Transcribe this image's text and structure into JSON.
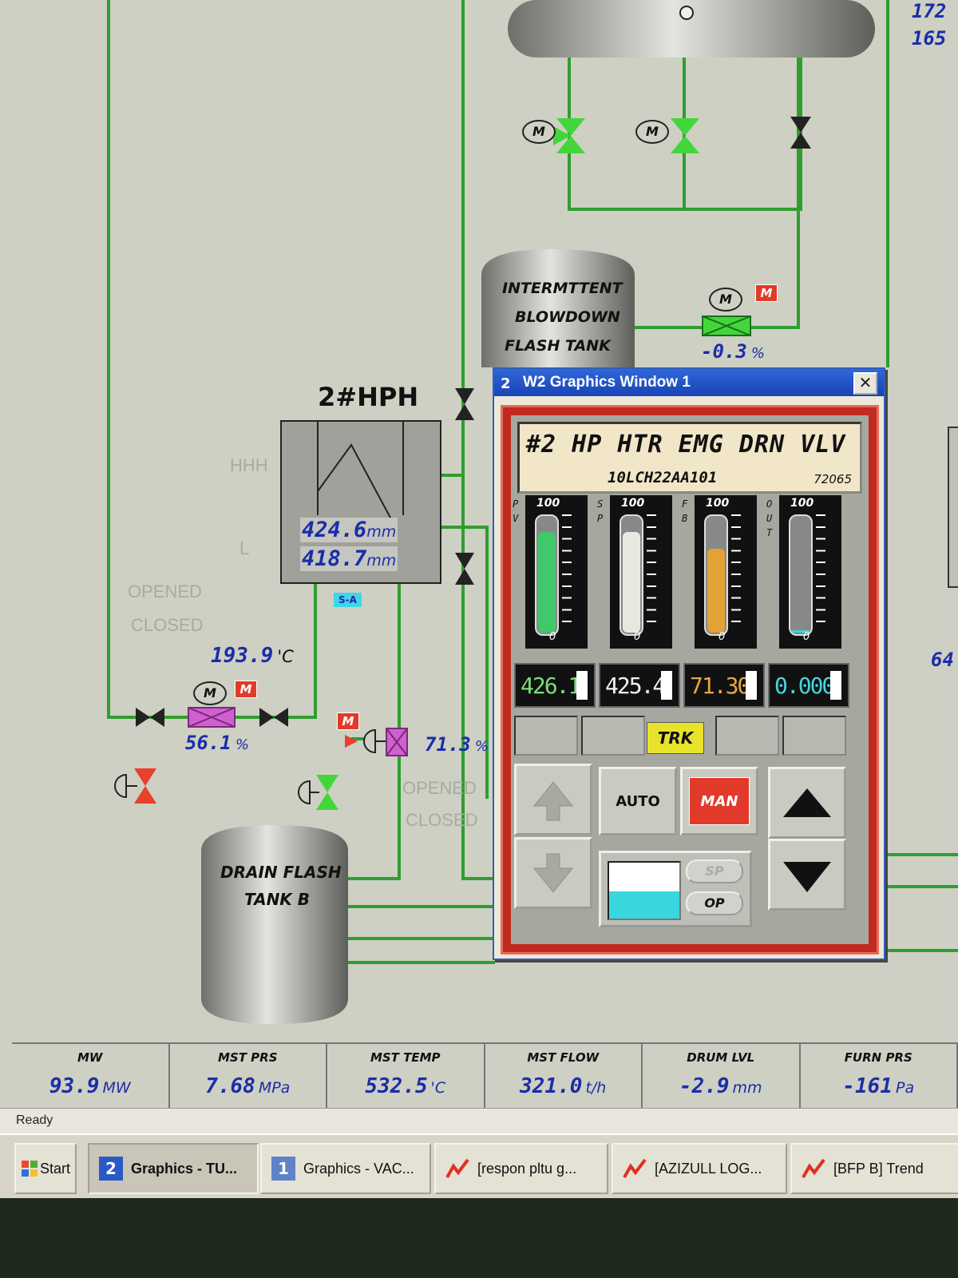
{
  "colors": {
    "pipe": "#2f9e30",
    "valve_green": "#43d63b",
    "valve_red": "#e8412c",
    "valve_magenta": "#d060d0",
    "value_blue": "#1b2da8",
    "bar_pv": "#3fc96a",
    "bar_sp": "#e8e8e0",
    "bar_fb": "#e2a236",
    "bar_out": "#39d6de"
  },
  "top_right_values": [
    "172",
    "165"
  ],
  "right_edge_value": "64",
  "vessels": {
    "intermittent": {
      "lines": [
        "INTERMTTENT",
        "BLOWDOWN",
        "FLASH TANK"
      ]
    },
    "drain": {
      "lines": [
        "DRAIN FLASH",
        "TANK B"
      ]
    }
  },
  "heater": {
    "title": "2#HPH",
    "level_labels": {
      "hhh": "HHH",
      "l": "L"
    },
    "level1": "424.6",
    "level2": "418.7",
    "unit": "mm",
    "tag": "S-A"
  },
  "valve_status": {
    "opened": "OPENED",
    "closed": "CLOSED"
  },
  "temperature": {
    "value": "193.9",
    "unit": "'C"
  },
  "valve_outputs": {
    "blowdown": {
      "value": "-0.3",
      "unit": "%"
    },
    "heater_outlet": {
      "value": "56.1",
      "unit": "%"
    },
    "emergency_drain": {
      "value": "71.3",
      "unit": "%"
    }
  },
  "motor_label": "M",
  "manual_badge": "M",
  "faceplate": {
    "window_number": "2",
    "window_title": "W2 Graphics Window 1",
    "close_glyph": "✕",
    "title": "#2 HP HTR EMG DRN VLV",
    "tag_id": "10LCH22AA101",
    "code": "72065",
    "bars": [
      {
        "letters": "P V",
        "max": "100",
        "min": "0",
        "level": 0.85,
        "color_key": "bar_pv",
        "value": "426.1",
        "value_color": "#7ddc7a"
      },
      {
        "letters": "S P",
        "max": "100",
        "min": "0",
        "level": 0.85,
        "color_key": "bar_sp",
        "value": "425.4",
        "value_color": "#f1f1f1"
      },
      {
        "letters": "F B",
        "max": "100",
        "min": "0",
        "level": 0.71,
        "color_key": "bar_fb",
        "value": "71.30",
        "value_color": "#e6a844"
      },
      {
        "letters": "O U T",
        "max": "100",
        "min": "0",
        "level": 0.02,
        "color_key": "bar_out",
        "value": "0.000",
        "value_color": "#46d6e0"
      }
    ],
    "mode_indicator": "TRK",
    "auto_label": "AUTO",
    "man_label": "MAN",
    "sp_label": "SP",
    "op_label": "OP",
    "entry_level": 0.48
  },
  "status_bar": [
    {
      "title": "MW",
      "value": "93.9",
      "unit": "MW"
    },
    {
      "title": "MST PRS",
      "value": "7.68",
      "unit": "MPa"
    },
    {
      "title": "MST TEMP",
      "value": "532.5",
      "unit": "'C"
    },
    {
      "title": "MST FLOW",
      "value": "321.0",
      "unit": "t/h"
    },
    {
      "title": "DRUM LVL",
      "value": "-2.9",
      "unit": "mm"
    },
    {
      "title": "FURN PRS",
      "value": "-161",
      "unit": "Pa"
    }
  ],
  "ready_text": "Ready",
  "taskbar": {
    "start": "Start",
    "items": [
      {
        "label": "Graphics - TU...",
        "icon": "2"
      },
      {
        "label": "Graphics - VAC...",
        "icon": "1"
      },
      {
        "label": "[respon pltu g...",
        "icon": "trend"
      },
      {
        "label": "[AZIZULL LOG...",
        "icon": "trend"
      },
      {
        "label": "[BFP B] Trend",
        "icon": "trend"
      }
    ]
  }
}
